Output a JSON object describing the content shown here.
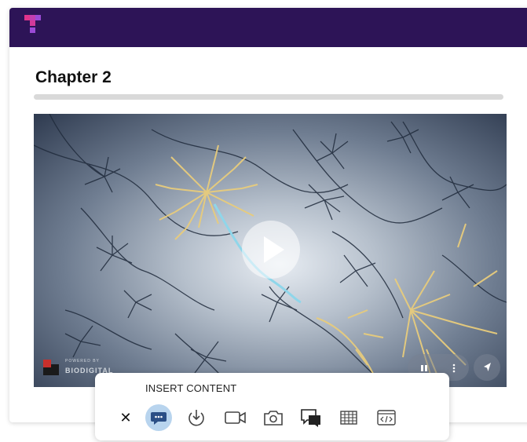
{
  "chapter": {
    "title": "Chapter 2",
    "progress": 0
  },
  "video": {
    "brand_line1": "POWERED BY",
    "brand_name": "BIODIGITAL",
    "controls": [
      "play",
      "pause",
      "more",
      "share"
    ]
  },
  "insert_panel": {
    "label": "INSERT CONTENT",
    "tools": [
      "close-icon",
      "comment-icon",
      "download-icon",
      "video-camera-icon",
      "photo-camera-icon",
      "chat-icon",
      "table-icon",
      "code-icon"
    ],
    "active_tool": "comment-icon"
  },
  "colors": {
    "topbar": "#2d1457",
    "logo_magenta": "#e0348c",
    "logo_purple": "#9b4bd6",
    "active_tool_bg": "#b8d4ee"
  }
}
